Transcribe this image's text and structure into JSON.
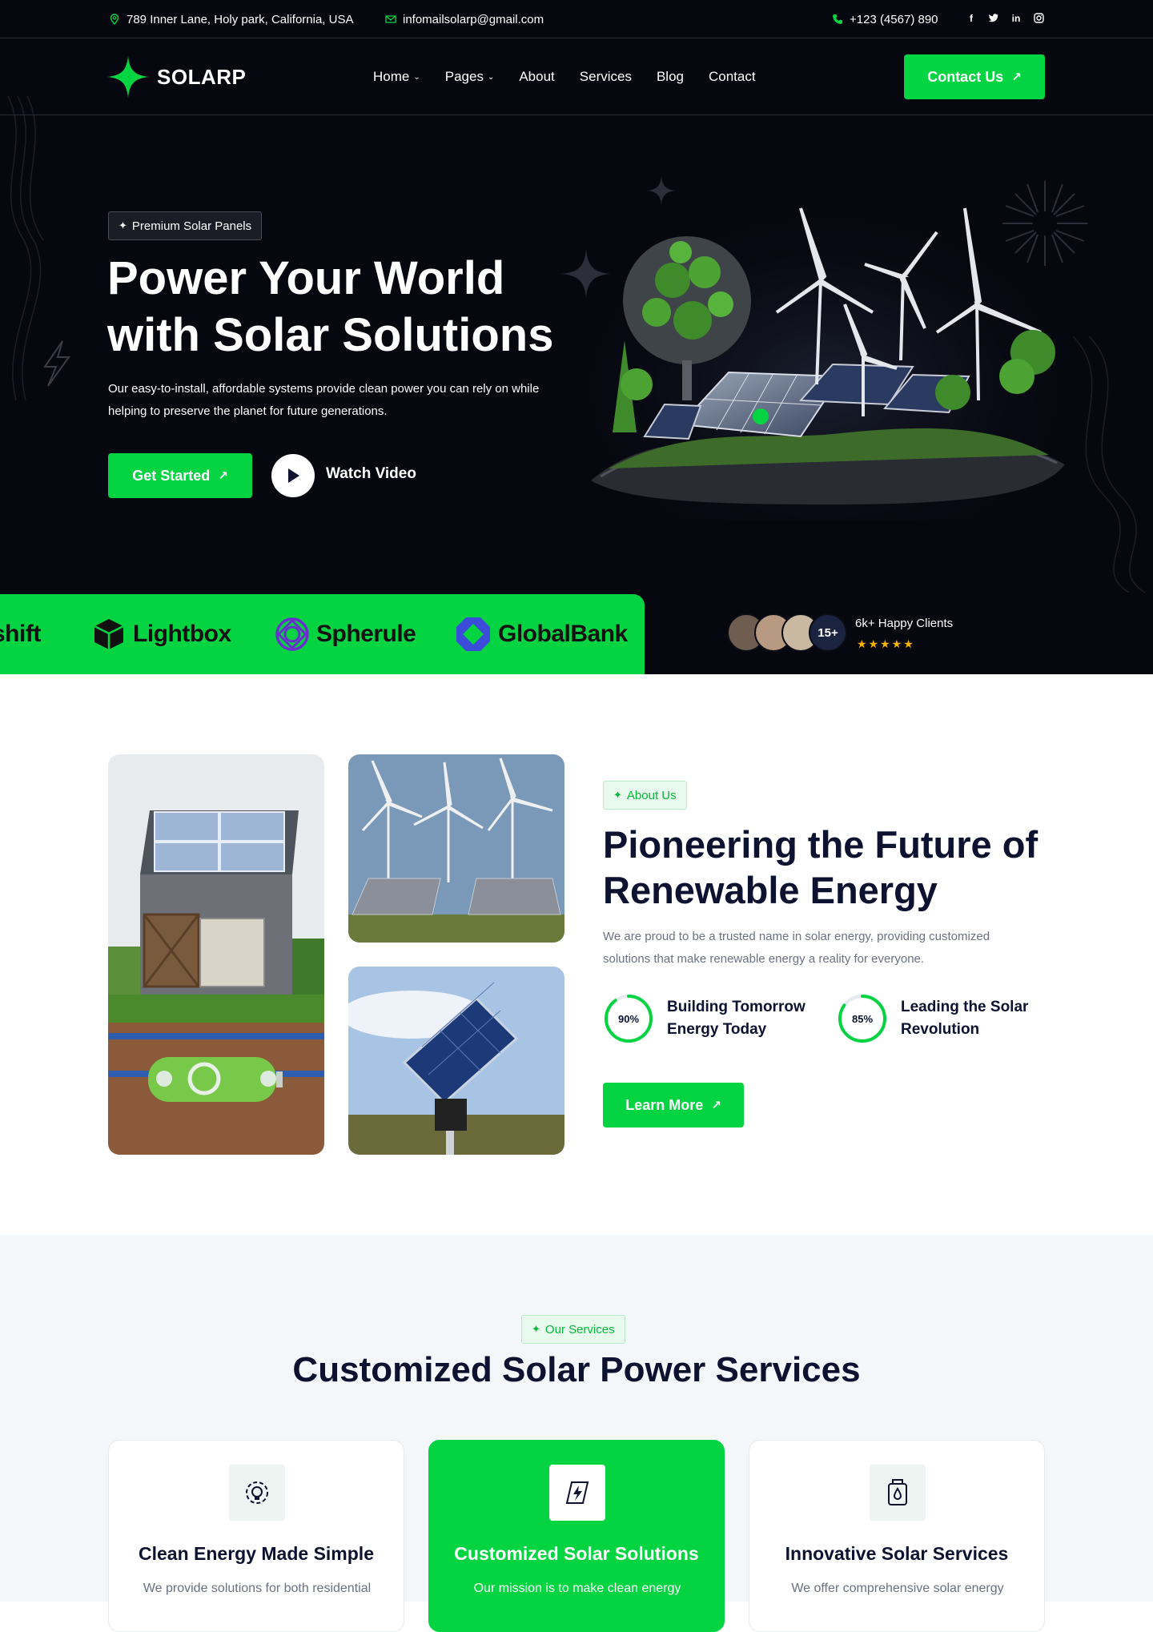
{
  "topbar": {
    "address": "789 Inner Lane, Holy park, California, USA",
    "email": "infomailsolarp@gmail.com",
    "phone": "+123 (4567) 890",
    "social": [
      "f",
      "t",
      "in",
      "ig"
    ]
  },
  "brand": {
    "name": "SOLARP"
  },
  "nav": {
    "items": [
      {
        "label": "Home",
        "has_dropdown": true
      },
      {
        "label": "Pages",
        "has_dropdown": true
      },
      {
        "label": "About",
        "has_dropdown": false
      },
      {
        "label": "Services",
        "has_dropdown": false
      },
      {
        "label": "Blog",
        "has_dropdown": false
      },
      {
        "label": "Contact",
        "has_dropdown": false
      }
    ],
    "cta_label": "Contact Us"
  },
  "hero": {
    "badge": "Premium Solar Panels",
    "title_line1": "Power Your World",
    "title_line2": "with Solar Solutions",
    "description": "Our easy-to-install, affordable systems provide clean power you can rely on while helping to preserve the planet for future generations.",
    "primary_button": "Get Started",
    "video_label": "Watch Video"
  },
  "partners": [
    "shift",
    "Lightbox",
    "Spherule",
    "GlobalBank"
  ],
  "clients": {
    "count_badge": "15+",
    "label": "6k+ Happy Clients",
    "rating": 5,
    "stars": "★★★★★"
  },
  "about": {
    "badge": "About Us",
    "title": "Pioneering the Future of Renewable Energy",
    "description": "We are proud to be a trusted name in solar energy, providing customized solutions that make renewable energy a reality for everyone.",
    "stats": [
      {
        "percent": "90%",
        "value": 90,
        "label_line1": "Building Tomorrow",
        "label_line2": "Energy Today"
      },
      {
        "percent": "85%",
        "value": 85,
        "label_line1": "Leading the Solar",
        "label_line2": "Revolution"
      }
    ],
    "button": "Learn More"
  },
  "services": {
    "badge": "Our Services",
    "title": "Customized Solar Power Services",
    "cards": [
      {
        "title": "Clean Energy Made Simple",
        "text": "We provide solutions for both residential",
        "icon": "gear-bulb-icon",
        "active": false
      },
      {
        "title": "Customized Solar Solutions",
        "text": "Our mission is to make clean energy",
        "icon": "solar-bolt-icon",
        "active": true
      },
      {
        "title": "Innovative Solar Services",
        "text": "We offer comprehensive solar energy",
        "icon": "battery-drop-icon",
        "active": false
      }
    ]
  },
  "colors": {
    "accent": "#05d442",
    "dark": "#06070f",
    "navy": "#0c1230",
    "muted": "#6b7180"
  }
}
